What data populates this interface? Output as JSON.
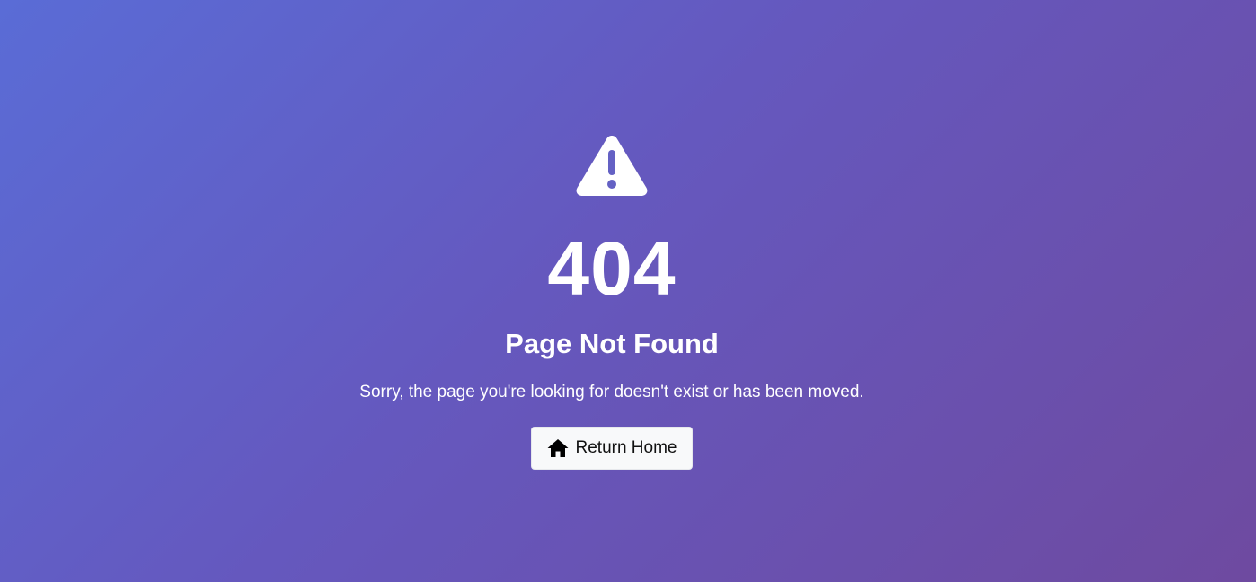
{
  "error": {
    "icon": "warning-triangle-icon",
    "code": "404",
    "title": "Page Not Found",
    "message": "Sorry, the page you're looking for doesn't exist or has been moved."
  },
  "actions": {
    "home_button": {
      "icon": "home-icon",
      "label": "Return Home"
    }
  },
  "colors": {
    "gradient_start": "#5a6cd6",
    "gradient_end": "#6e4aa0",
    "text": "#ffffff",
    "button_bg": "#f8f9fa",
    "button_text": "#111111"
  }
}
